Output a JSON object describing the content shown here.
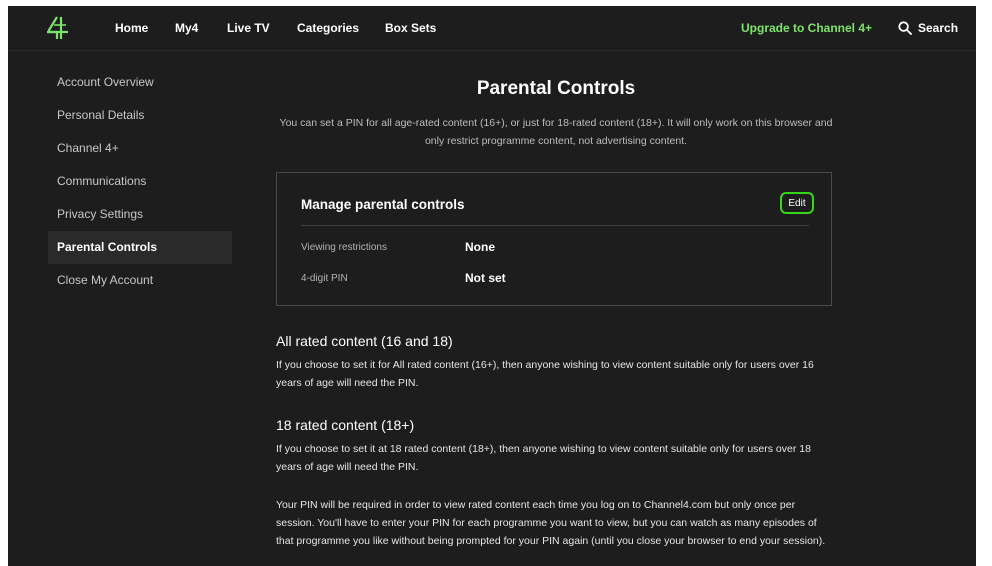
{
  "header": {
    "logo_icon": "channel-4-logo-icon",
    "nav": [
      {
        "label": "Home"
      },
      {
        "label": "My4"
      },
      {
        "label": "Live TV"
      },
      {
        "label": "Categories"
      },
      {
        "label": "Box Sets"
      }
    ],
    "upgrade_label": "Upgrade to Channel 4+",
    "search_label": "Search",
    "search_icon": "search-icon"
  },
  "sidebar": {
    "items": [
      {
        "label": "Account Overview"
      },
      {
        "label": "Personal Details"
      },
      {
        "label": "Channel 4+"
      },
      {
        "label": "Communications"
      },
      {
        "label": "Privacy Settings"
      },
      {
        "label": "Parental Controls",
        "active": true
      },
      {
        "label": "Close My Account"
      }
    ]
  },
  "main": {
    "title": "Parental Controls",
    "intro": "You can set a PIN for all age-rated content (16+), or just for 18-rated content (18+). It will only work on this browser and only restrict programme content, not advertising content.",
    "card": {
      "title": "Manage parental controls",
      "edit_label": "Edit",
      "rows": [
        {
          "label": "Viewing restrictions",
          "value": "None"
        },
        {
          "label": "4-digit PIN",
          "value": "Not set"
        }
      ]
    },
    "sections": [
      {
        "heading": "All rated content (16 and 18)",
        "body": "If you choose to set it for All rated content (16+), then anyone wishing to view content suitable only for users over 16 years of age will need the PIN."
      },
      {
        "heading": "18 rated content (18+)",
        "body": "If you choose to set it at 18 rated content (18+), then anyone wishing to view content suitable only for users over 18 years of age will need the PIN."
      }
    ],
    "pin_note": "Your PIN will be required in order to view rated content each time you log on to Channel4.com but only once per session. You'll have to enter your PIN for each programme you want to view, but you can watch as many episodes of that programme you like without being prompted for your PIN again (until you close your browser to end your session)."
  },
  "colors": {
    "background": "#1d1d1d",
    "accent_green": "#7ee36a",
    "focus_ring": "#35d51a",
    "sidebar_active_bg": "#2a2a2a"
  }
}
